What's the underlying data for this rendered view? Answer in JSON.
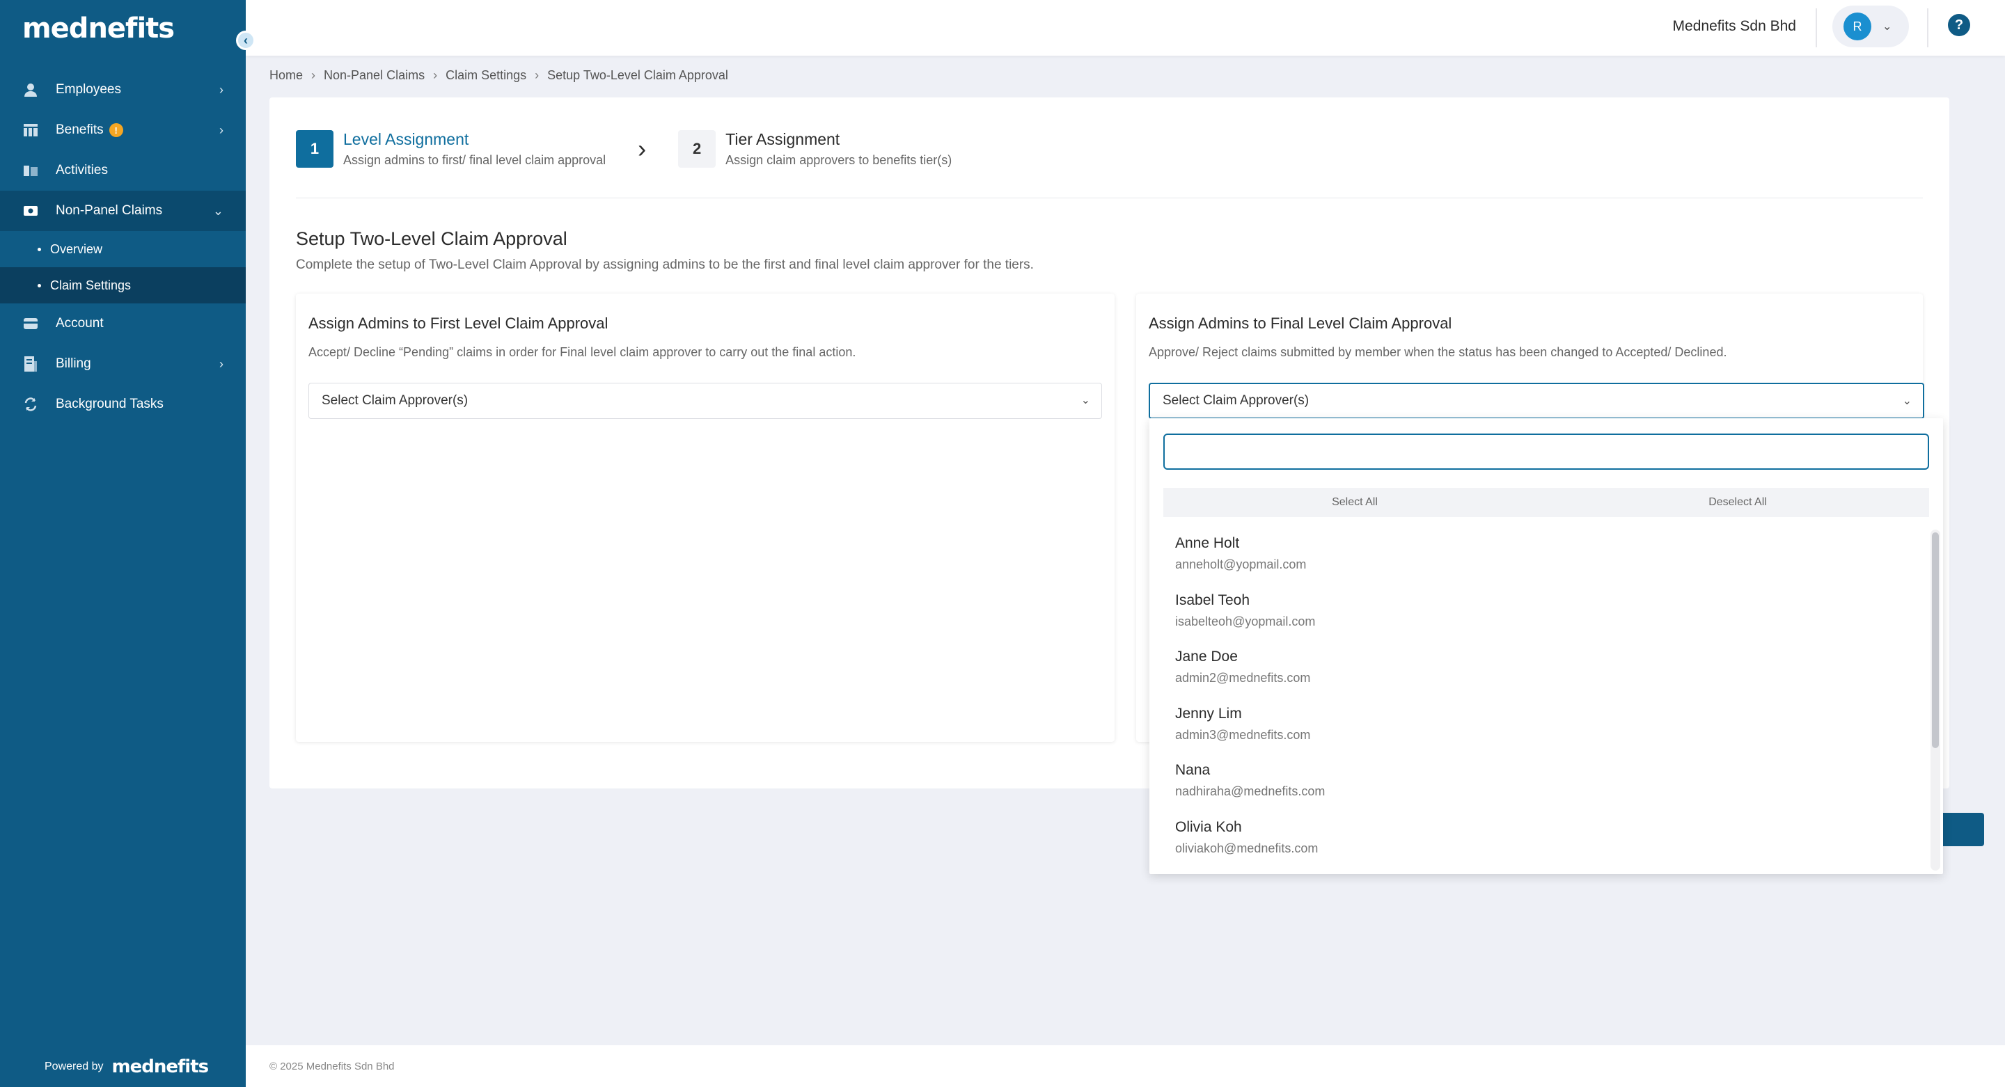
{
  "brand": {
    "logo_text": "mednefits",
    "powered_by": "Powered by",
    "accent": "#0f5b85",
    "step_active": "#0f6e9e"
  },
  "sidebar": {
    "items": [
      {
        "label": "Employees",
        "icon": "person-icon",
        "has_chevron": true
      },
      {
        "label": "Benefits",
        "icon": "table-icon",
        "has_chevron": true,
        "badge": "!"
      },
      {
        "label": "Activities",
        "icon": "book-icon",
        "has_chevron": false
      },
      {
        "label": "Non-Panel Claims",
        "icon": "cash-icon",
        "has_chevron": true,
        "expanded": true
      },
      {
        "label": "Account",
        "icon": "card-icon",
        "has_chevron": false
      },
      {
        "label": "Billing",
        "icon": "invoice-icon",
        "has_chevron": true
      },
      {
        "label": "Background Tasks",
        "icon": "refresh-icon",
        "has_chevron": false
      }
    ],
    "sub_items": [
      {
        "label": "Overview"
      },
      {
        "label": "Claim Settings",
        "active": true
      }
    ]
  },
  "topbar": {
    "company": "Mednefits Sdn Bhd",
    "avatar_initial": "R",
    "help": "?"
  },
  "breadcrumb": [
    "Home",
    "Non-Panel Claims",
    "Claim Settings",
    "Setup Two-Level Claim Approval"
  ],
  "steps": [
    {
      "num": "1",
      "title": "Level Assignment",
      "sub": "Assign admins to first/ final level claim approval"
    },
    {
      "num": "2",
      "title": "Tier Assignment",
      "sub": "Assign claim approvers to benefits tier(s)"
    }
  ],
  "section": {
    "title": "Setup Two-Level Claim Approval",
    "desc": "Complete the setup of Two-Level Claim Approval by assigning admins to be the first and final level claim approver for the tiers."
  },
  "first_level": {
    "title": "Assign Admins to First Level Claim Approval",
    "desc": "Accept/ Decline “Pending” claims in order for Final level claim approver to carry out the final action.",
    "select_placeholder": "Select Claim Approver(s)"
  },
  "final_level": {
    "title": "Assign Admins to Final Level Claim Approval",
    "desc": "Approve/ Reject claims submitted by member when the status has been changed to Accepted/ Declined.",
    "select_placeholder": "Select Claim Approver(s)"
  },
  "dropdown": {
    "search_value": "",
    "select_all": "Select All",
    "deselect_all": "Deselect All",
    "options": [
      {
        "name": "Anne Holt",
        "email": "anneholt@yopmail.com"
      },
      {
        "name": "Isabel Teoh",
        "email": "isabelteoh@yopmail.com"
      },
      {
        "name": "Jane Doe",
        "email": "admin2@mednefits.com"
      },
      {
        "name": "Jenny Lim",
        "email": "admin3@mednefits.com"
      },
      {
        "name": "Nana",
        "email": "nadhiraha@mednefits.com"
      },
      {
        "name": "Olivia Koh",
        "email": "oliviakoh@mednefits.com"
      }
    ]
  },
  "footer": {
    "copyright": "© 2025 Mednefits Sdn Bhd"
  }
}
